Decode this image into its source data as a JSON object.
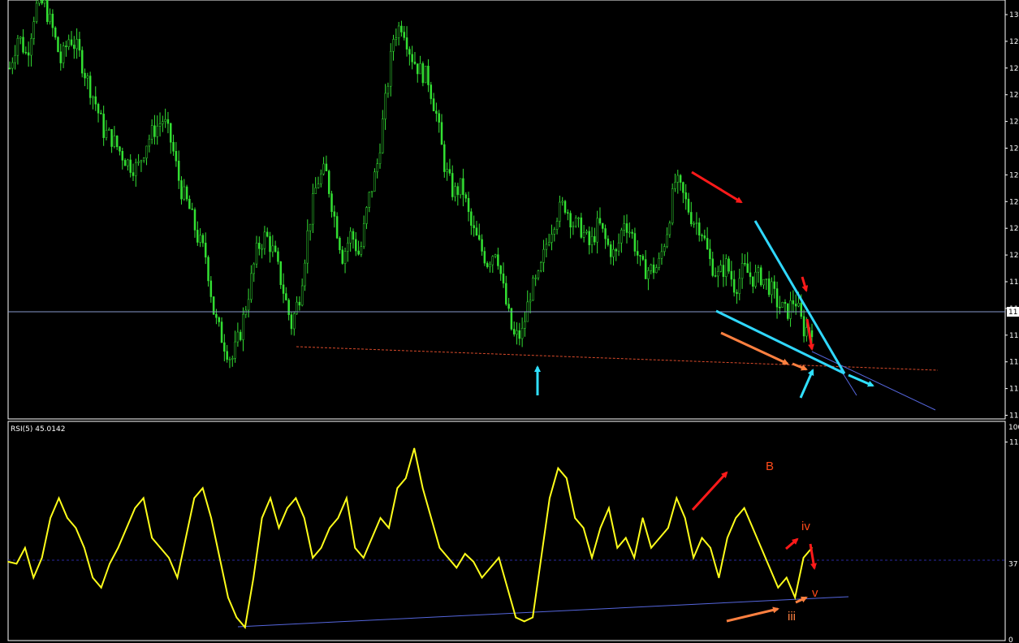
{
  "chart_data": [
    {
      "type": "candlestick",
      "panel": "price",
      "ylim": [
        110,
        131
      ],
      "y_tick_labels": [
        "13",
        "12",
        "12",
        "12",
        "12",
        "12",
        "12",
        "12",
        "12",
        "12",
        "11",
        "11",
        "11",
        "11",
        "11",
        "11",
        "11"
      ],
      "current_price_label": "11",
      "grid": false,
      "colors": {
        "candles": "#33e033",
        "current_line": "#8899cc",
        "support_dashed": "#d94a2a",
        "trendline": "#30d8ff",
        "channel": "#5566dd"
      },
      "close_series": [
        127.7,
        129.4,
        128.3,
        130.8,
        131.0,
        129.7,
        128.0,
        129.3,
        128.6,
        127.2,
        126.0,
        124.5,
        124.1,
        123.4,
        122.8,
        122.6,
        123.9,
        124.6,
        125.1,
        123.8,
        121.6,
        120.6,
        119.1,
        118.1,
        115.0,
        113.8,
        112.8,
        114.2,
        116.3,
        118.5,
        119.2,
        118.2,
        116.5,
        114.6,
        116.2,
        119.6,
        121.9,
        122.5,
        120.2,
        118.1,
        119.3,
        118.1,
        120.9,
        122.6,
        125.9,
        129.4,
        130.0,
        128.4,
        127.6,
        127.2,
        125.3,
        122.6,
        121.3,
        121.7,
        119.7,
        118.7,
        117.8,
        118.6,
        116.0,
        114.0,
        114.1,
        116.3,
        117.0,
        119.0,
        120.2,
        120.8,
        119.8,
        119.5,
        118.6,
        119.8,
        118.7,
        118.1,
        120.0,
        119.1,
        117.5,
        117.4,
        117.6,
        119.4,
        122.0,
        121.1,
        120.0,
        119.6,
        117.9,
        117.1,
        117.7,
        116.5,
        117.5,
        117.0,
        117.1,
        116.6,
        115.7,
        115.2,
        116.0,
        114.4,
        114.5
      ],
      "annotations_text": [],
      "annotations": [
        {
          "type": "arrow",
          "color": "#ff1a1a",
          "desc": "down-right"
        },
        {
          "type": "arrow",
          "color": "#ff1a1a",
          "desc": "down"
        },
        {
          "type": "arrow",
          "color": "#ff1a1a",
          "desc": "down"
        },
        {
          "type": "arrow",
          "color": "#ff8040",
          "desc": "down-right"
        },
        {
          "type": "arrow",
          "color": "#30e0ff",
          "desc": "up"
        },
        {
          "type": "arrow",
          "color": "#30e0ff",
          "desc": "up-right"
        },
        {
          "type": "arrow",
          "color": "#30e0ff",
          "desc": "right"
        }
      ]
    },
    {
      "type": "line",
      "panel": "indicator",
      "title": "RSI(5) 45.0142",
      "ylim": [
        0,
        100
      ],
      "y_tick_labels": [
        "100",
        "37",
        "0"
      ],
      "level_line": 37,
      "series": [
        {
          "name": "RSI(5)",
          "color": "#ffff1a",
          "values": [
            38,
            37,
            45,
            30,
            40,
            60,
            70,
            60,
            55,
            45,
            30,
            25,
            37,
            45,
            55,
            65,
            70,
            50,
            45,
            40,
            30,
            50,
            70,
            75,
            60,
            40,
            20,
            10,
            5,
            30,
            60,
            70,
            55,
            65,
            70,
            60,
            40,
            45,
            55,
            60,
            70,
            45,
            40,
            50,
            60,
            55,
            75,
            80,
            95,
            75,
            60,
            45,
            40,
            35,
            42,
            38,
            30,
            35,
            40,
            25,
            10,
            8,
            10,
            40,
            70,
            85,
            80,
            60,
            55,
            40,
            55,
            65,
            45,
            50,
            40,
            60,
            45,
            50,
            55,
            70,
            60,
            40,
            50,
            45,
            30,
            50,
            60,
            65,
            55,
            45,
            35,
            25,
            30,
            20,
            40,
            45
          ]
        }
      ],
      "labels": [
        "B",
        "iv",
        "v",
        "iii"
      ],
      "colors": {
        "label": "#ff4a1a",
        "label_iii": "#ff8040",
        "support": "#5566dd",
        "level": "#2a2aa0"
      }
    }
  ]
}
